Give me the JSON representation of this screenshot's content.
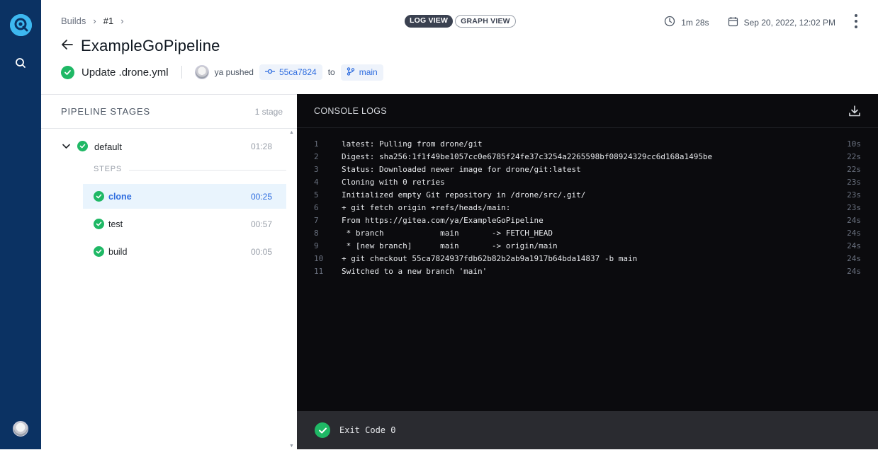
{
  "rail": {
    "logo": "drone-logo-icon",
    "search": "search-icon",
    "avatar": "user-avatar"
  },
  "breadcrumb": {
    "root": "Builds",
    "current": "#1"
  },
  "title": "ExampleGoPipeline",
  "commit": {
    "message": "Update .drone.yml",
    "author_action": "ya pushed",
    "sha": "55ca7824",
    "to": "to",
    "branch": "main"
  },
  "view_toggle": {
    "log": "LOG VIEW",
    "graph": "GRAPH VIEW",
    "active": "log"
  },
  "meta": {
    "duration": "1m 28s",
    "date": "Sep 20, 2022, 12:02 PM"
  },
  "stages": {
    "title": "PIPELINE STAGES",
    "count": "1 stage",
    "stage": {
      "name": "default",
      "time": "01:28"
    },
    "steps_label": "STEPS",
    "steps": [
      {
        "name": "clone",
        "time": "00:25",
        "selected": true
      },
      {
        "name": "test",
        "time": "00:57",
        "selected": false
      },
      {
        "name": "build",
        "time": "00:05",
        "selected": false
      }
    ]
  },
  "console": {
    "title": "CONSOLE LOGS",
    "lines": [
      {
        "n": "1",
        "text": "latest: Pulling from drone/git",
        "t": "10s"
      },
      {
        "n": "2",
        "text": "Digest: sha256:1f1f49be1057cc0e6785f24fe37c3254a2265598bf08924329cc6d168a1495be",
        "t": "22s"
      },
      {
        "n": "3",
        "text": "Status: Downloaded newer image for drone/git:latest",
        "t": "22s"
      },
      {
        "n": "4",
        "text": "Cloning with 0 retries",
        "t": "23s"
      },
      {
        "n": "5",
        "text": "Initialized empty Git repository in /drone/src/.git/",
        "t": "23s"
      },
      {
        "n": "6",
        "text": "+ git fetch origin +refs/heads/main:",
        "t": "23s"
      },
      {
        "n": "7",
        "text": "From https://gitea.com/ya/ExampleGoPipeline",
        "t": "24s"
      },
      {
        "n": "8",
        "text": " * branch            main       -> FETCH_HEAD",
        "t": "24s"
      },
      {
        "n": "9",
        "text": " * [new branch]      main       -> origin/main",
        "t": "24s"
      },
      {
        "n": "10",
        "text": "+ git checkout 55ca7824937fdb62b82b2ab9a1917b64bda14837 -b main",
        "t": "24s"
      },
      {
        "n": "11",
        "text": "Switched to a new branch 'main'",
        "t": "24s"
      }
    ],
    "exit": "Exit Code 0"
  },
  "colors": {
    "rail": "#0b3263",
    "success": "#1fb865",
    "link": "#2d6cdf",
    "console_bg": "#0b0b0e"
  }
}
